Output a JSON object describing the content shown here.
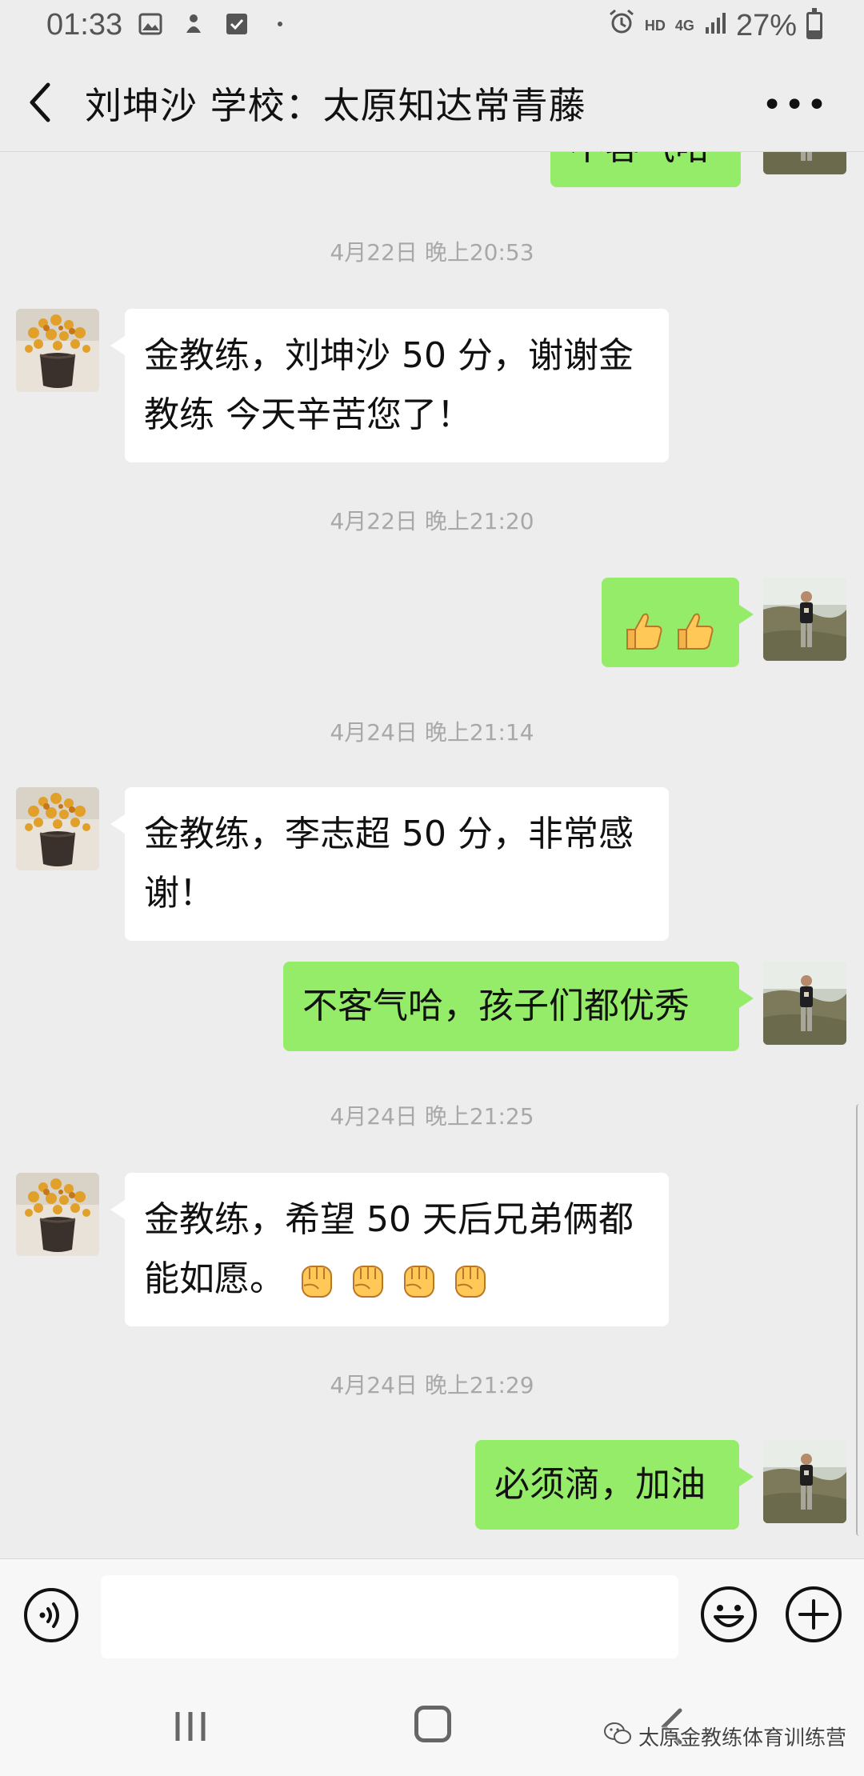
{
  "status_bar": {
    "time": "01:33",
    "hd": "HD",
    "network": "4G",
    "battery_text": "27%",
    "battery_level": 0.27
  },
  "header": {
    "title": "刘坤沙   学校：太原知达常青藤",
    "back_icon": "chevron-left-icon",
    "more_icon": "more-dots-icon"
  },
  "messages": [
    {
      "kind": "out_partial",
      "text": "不客气哈"
    },
    {
      "kind": "time",
      "text": "4月22日 晚上20:53"
    },
    {
      "kind": "in",
      "line1": "金教练，刘坤沙 50 分，谢谢金",
      "line2": "教练 今天辛苦您了！"
    },
    {
      "kind": "time",
      "text": "4月22日 晚上21:20"
    },
    {
      "kind": "out_emoji",
      "emoji": "thumbs-up-icon",
      "count": 2
    },
    {
      "kind": "time",
      "text": "4月24日 晚上21:14"
    },
    {
      "kind": "in",
      "line1": "金教练，李志超 50 分，非常感",
      "line2": "谢！"
    },
    {
      "kind": "out",
      "text": "不客气哈，孩子们都优秀"
    },
    {
      "kind": "time",
      "text": "4月24日 晚上21:25"
    },
    {
      "kind": "in",
      "line1": "金教练，希望 50 天后兄弟俩都",
      "line2": "能如愿。",
      "emoji": "raised-fist-icon",
      "emoji_count": 4
    },
    {
      "kind": "time",
      "text": "4月24日 晚上21:29"
    },
    {
      "kind": "out",
      "text": "必须滴，加油"
    }
  ],
  "input": {
    "value": "",
    "voice_icon": "voice-icon",
    "emoji_icon": "emoji-face-icon",
    "plus_icon": "plus-icon"
  },
  "nav": {
    "watermark": "太原金教练体育训练营"
  },
  "colors": {
    "background": "#ededed",
    "bubble_out": "#95ec69",
    "bubble_in": "#ffffff",
    "timestamp": "#a8a8a8"
  }
}
